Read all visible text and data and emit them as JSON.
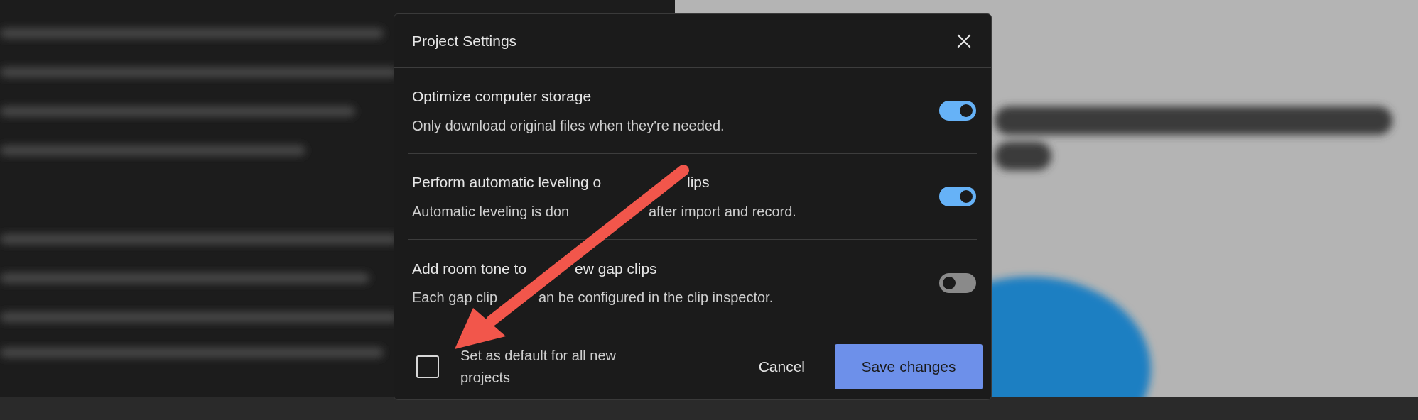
{
  "dialog": {
    "title": "Project Settings",
    "settings": [
      {
        "title": [
          "Optimize computer storage"
        ],
        "description": [
          "Only download original files when they're needed."
        ],
        "on": true
      },
      {
        "title": [
          "Perform automatic leveling o",
          "lips"
        ],
        "description": [
          "Automatic leveling is don",
          "after import and record."
        ],
        "on": true
      },
      {
        "title": [
          "Add room tone to",
          "ew gap clips"
        ],
        "description": [
          "Each gap clip",
          "an be configured in the clip inspector."
        ],
        "on": false
      }
    ],
    "default_checkbox": {
      "label": "Set as default for all new projects",
      "checked": false
    },
    "buttons": {
      "cancel": "Cancel",
      "save": "Save changes"
    }
  }
}
